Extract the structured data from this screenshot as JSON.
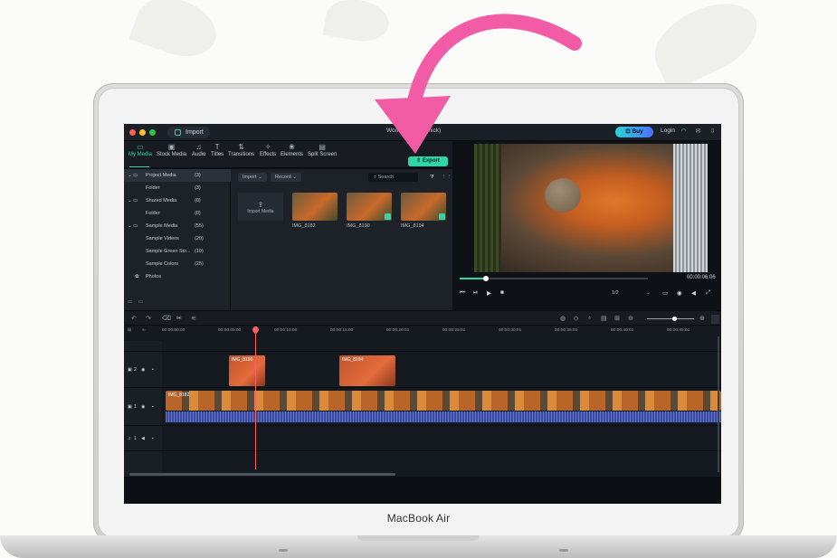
{
  "app": {
    "title": "Wonder... (Peachick)",
    "import_label": "Import",
    "buy_label": "Buy",
    "login_label": "Login"
  },
  "toolbar": {
    "tools": [
      {
        "label": "My Media",
        "icon": "folder-icon"
      },
      {
        "label": "Stock Media",
        "icon": "stock-icon"
      },
      {
        "label": "Audio",
        "icon": "music-icon"
      },
      {
        "label": "Titles",
        "icon": "text-icon"
      },
      {
        "label": "Transitions",
        "icon": "transition-icon"
      },
      {
        "label": "Effects",
        "icon": "effects-icon"
      },
      {
        "label": "Elements",
        "icon": "elements-icon"
      },
      {
        "label": "Split Screen",
        "icon": "split-screen-icon"
      }
    ],
    "export_label": "Export"
  },
  "sidebar": {
    "items": [
      {
        "label": "Project Media",
        "count": "(3)"
      },
      {
        "label": "Folder",
        "count": "(3)"
      },
      {
        "label": "Shared Media",
        "count": "(0)"
      },
      {
        "label": "Folder",
        "count": "(0)"
      },
      {
        "label": "Sample Media",
        "count": "(55)"
      },
      {
        "label": "Sample Videos",
        "count": "(20)"
      },
      {
        "label": "Sample Green Scr...",
        "count": "(10)"
      },
      {
        "label": "Sample Colors",
        "count": "(25)"
      },
      {
        "label": "Photos",
        "count": ""
      }
    ]
  },
  "media": {
    "import_btn": "Import",
    "record_btn": "Record",
    "search_placeholder": "Search",
    "import_tile_label": "Import Media",
    "items": [
      {
        "name": "IMG_8182"
      },
      {
        "name": "IMG_8190"
      },
      {
        "name": "IMG_8194"
      }
    ]
  },
  "preview": {
    "timecode": "00:00:06:06",
    "ratio": "1/2"
  },
  "timeline": {
    "ticks": [
      "00:00:00:00",
      "00:00:05:00",
      "00:00:10:00",
      "00:00:15:00",
      "00:00:20:01",
      "00:00:25:01",
      "00:00:30:01",
      "00:00:35:01",
      "00:00:40:01",
      "00:00:45:01"
    ],
    "tracks": [
      {
        "label": "2"
      },
      {
        "label": "1"
      },
      {
        "label": "1"
      }
    ],
    "clips": [
      {
        "name": "IMG_8190"
      },
      {
        "name": "IMG_8194"
      },
      {
        "name": "IMG_8182"
      }
    ]
  },
  "device": {
    "label": "MacBook Air"
  },
  "colors": {
    "accent": "#2fd6a8",
    "arrow": "#f25ba6",
    "playhead": "#ff5d5d"
  }
}
